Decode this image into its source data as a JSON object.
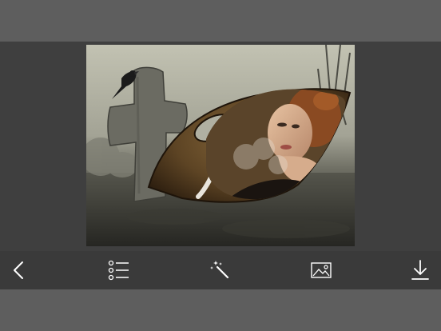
{
  "toolbar": {
    "buttons": [
      {
        "name": "back-button",
        "icon": "chevron-left-icon"
      },
      {
        "name": "list-button",
        "icon": "list-icon"
      },
      {
        "name": "magic-wand-button",
        "icon": "magic-wand-icon"
      },
      {
        "name": "gallery-button",
        "icon": "image-icon"
      },
      {
        "name": "download-button",
        "icon": "download-icon"
      }
    ],
    "icon_color": "#ffffff",
    "background": "#3a3a3a"
  },
  "colors": {
    "chrome": "#5e5e5e",
    "canvas_background": "#3f3f3f"
  }
}
